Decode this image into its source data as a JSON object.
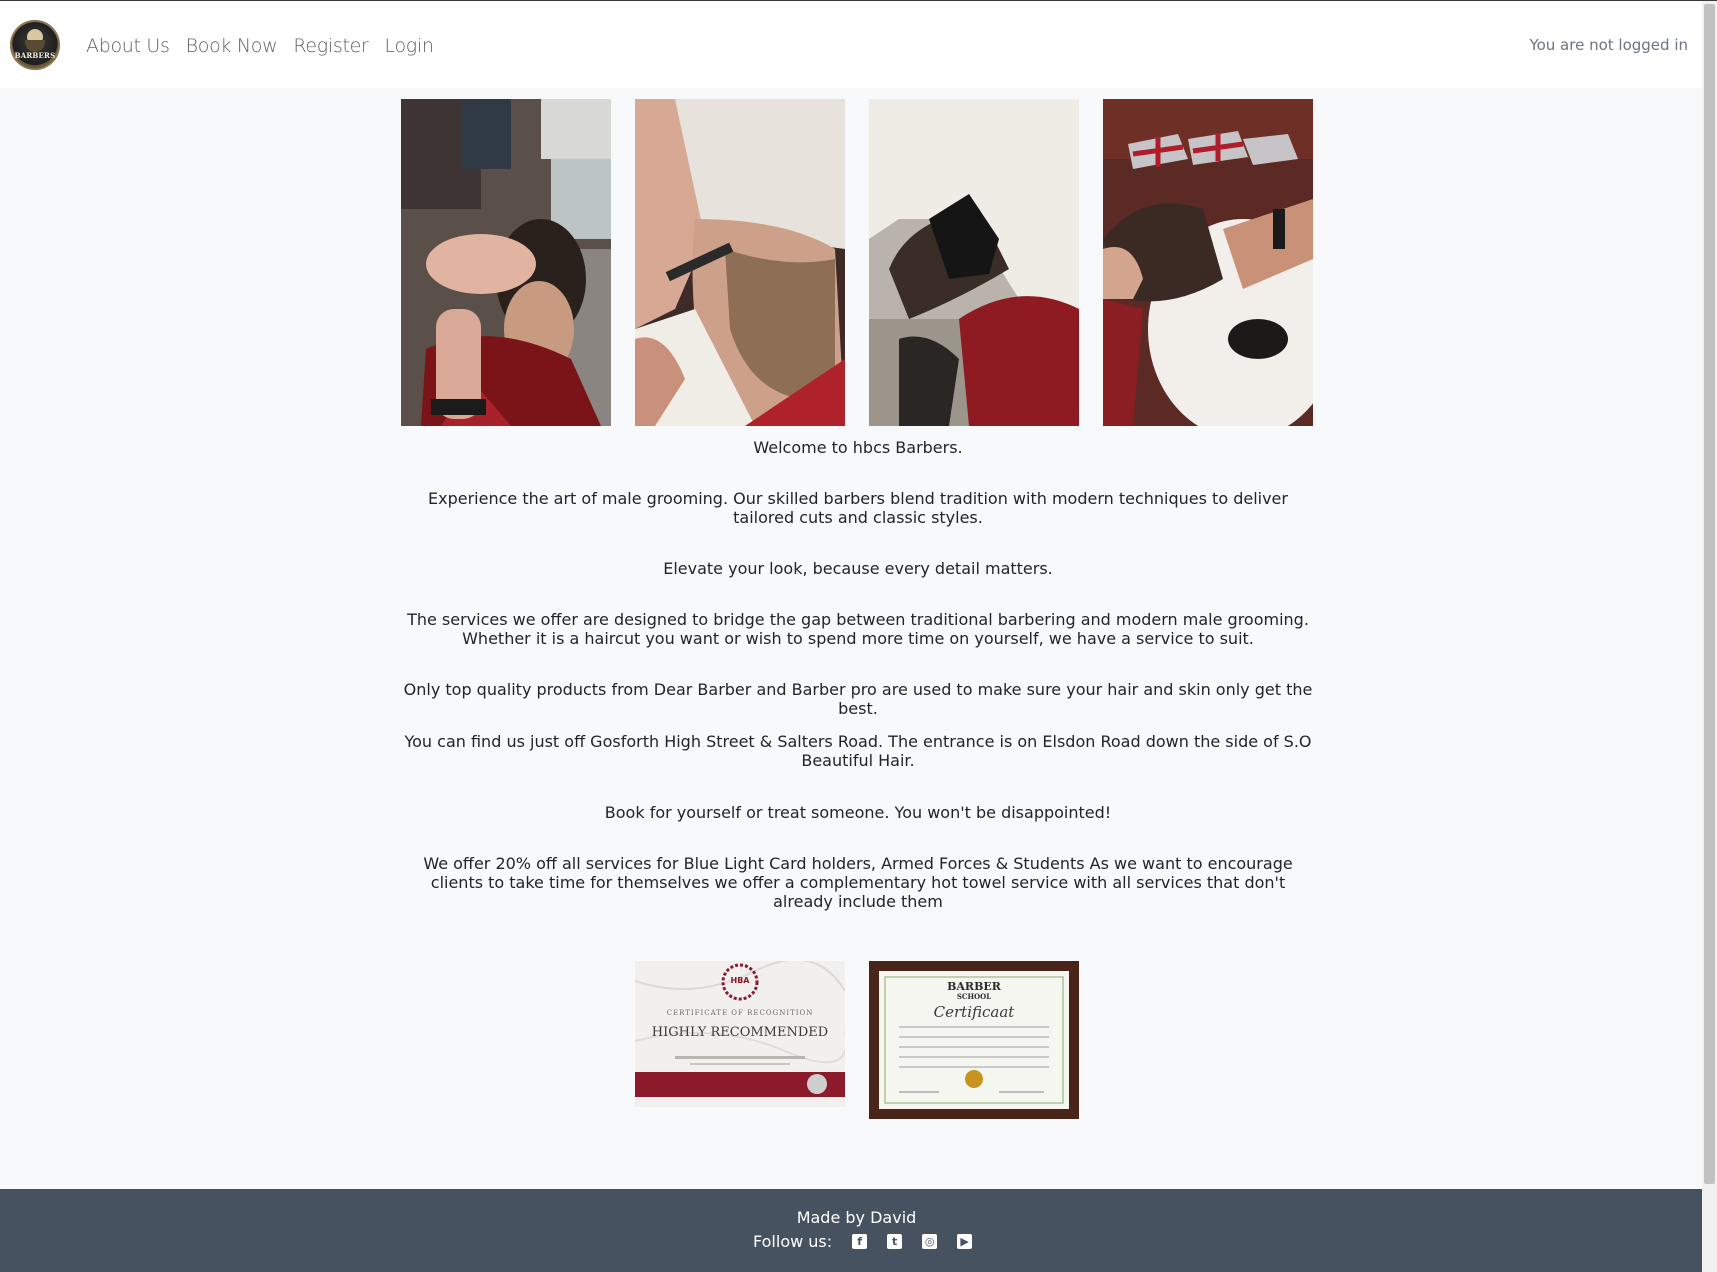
{
  "brand": {
    "logo_text": "BARBERS"
  },
  "nav": {
    "links": [
      "About Us",
      "Book Now",
      "Register",
      "Login"
    ],
    "status": "You are not logged in"
  },
  "gallery": {
    "photos": [
      "haircut-photo",
      "hot-towel-shave-photo",
      "face-mask-photo",
      "hair-wash-photo"
    ]
  },
  "content": {
    "paragraphs": [
      "Welcome to hbcs Barbers.",
      "Experience the art of male grooming. Our skilled barbers blend tradition with modern techniques to deliver tailored cuts and classic styles.",
      "Elevate your look, because every detail matters.",
      "The services we offer are designed to bridge the gap between traditional barbering and modern male grooming. Whether it is a haircut you want or wish to spend more time on yourself, we have a service to suit.",
      "Only top quality products from Dear Barber and Barber pro are used to make sure your hair and skin only get the best.",
      "You can find us just off Gosforth High Street & Salters Road. The entrance is on Elsdon Road down the side of S.O Beautiful Hair.",
      "Book for yourself or treat someone. You won't be disappointed!",
      "We offer 20% off all services for Blue Light Card holders, Armed Forces & Students As we want to encourage clients to take time for themselves we offer a complementary hot towel service with all services that don't already include them"
    ]
  },
  "certificates": {
    "recognition": {
      "logo": "HBA",
      "heading": "CERTIFICATE OF RECOGNITION",
      "title": "HIGHLY RECOMMENDED"
    },
    "school": {
      "brand_line1": "BARBER",
      "brand_line2": "SCHOOL",
      "title": "Certificaat"
    }
  },
  "footer": {
    "made_by": "Made by David",
    "follow_label": "Follow us:",
    "social": [
      "facebook-icon",
      "twitter-icon",
      "instagram-icon",
      "youtube-icon"
    ]
  },
  "colors": {
    "page_bg": "#f8f9fa",
    "navbar_bg": "#ffffff",
    "footer_bg": "#475260",
    "text": "#212529",
    "nav_link": "#5c6166",
    "cert_ribbon": "#8b1a2b"
  }
}
